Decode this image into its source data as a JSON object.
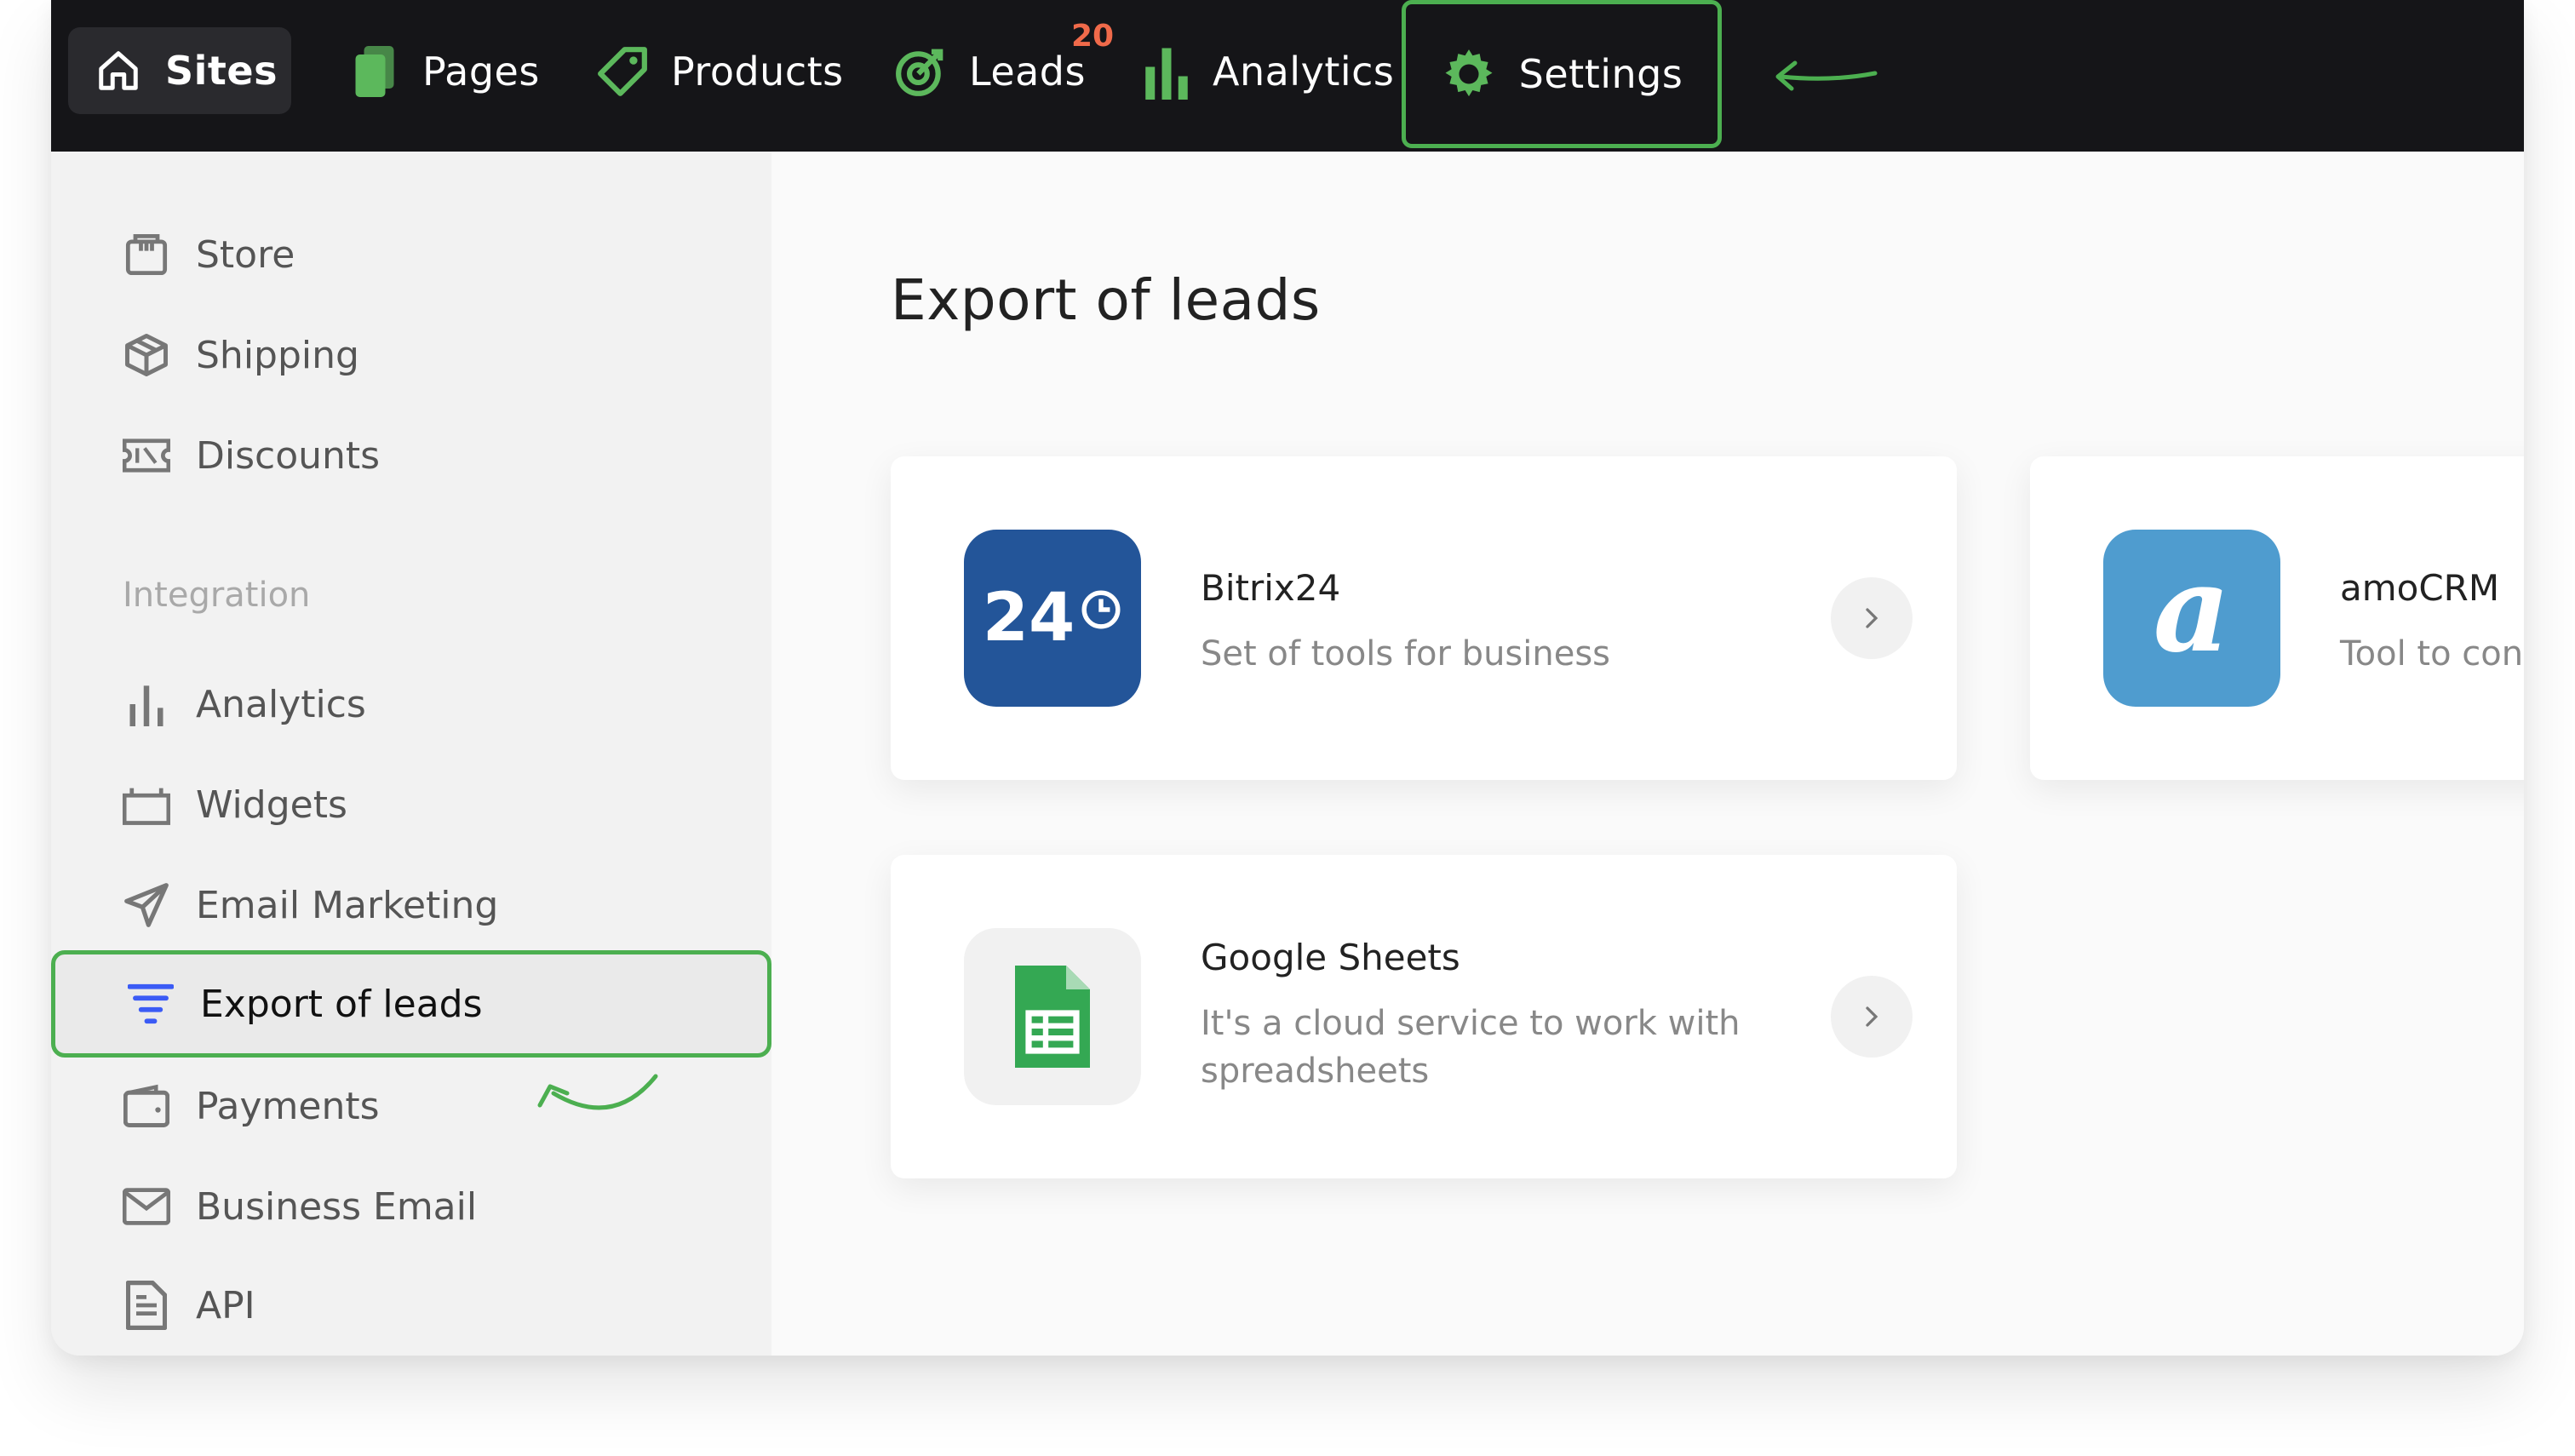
{
  "nav": {
    "items": [
      {
        "label": "Sites",
        "icon": "home-icon"
      },
      {
        "label": "Pages",
        "icon": "pages-icon"
      },
      {
        "label": "Products",
        "icon": "tag-icon"
      },
      {
        "label": "Leads",
        "icon": "target-icon",
        "badge": "20"
      },
      {
        "label": "Analytics",
        "icon": "bar-chart-icon"
      },
      {
        "label": "Settings",
        "icon": "gear-icon"
      }
    ],
    "accent": "#4caf50",
    "badge_color": "#f06a4a"
  },
  "sidebar": {
    "items_top": [
      {
        "label": "Store",
        "icon": "store-icon"
      },
      {
        "label": "Shipping",
        "icon": "box-icon"
      },
      {
        "label": "Discounts",
        "icon": "ticket-icon"
      }
    ],
    "heading": "Integration",
    "items_integration": [
      {
        "label": "Analytics",
        "icon": "bar-chart-icon"
      },
      {
        "label": "Widgets",
        "icon": "widget-icon"
      },
      {
        "label": "Email Marketing",
        "icon": "send-icon"
      },
      {
        "label": "Export of leads",
        "icon": "filter-icon",
        "active": true
      },
      {
        "label": "Payments",
        "icon": "wallet-icon"
      },
      {
        "label": "Business Email",
        "icon": "mail-icon"
      },
      {
        "label": "API",
        "icon": "document-icon"
      }
    ]
  },
  "main": {
    "title": "Export of leads",
    "cards": [
      {
        "name": "Bitrix24",
        "description": "Set of tools for business",
        "logo_text": "24",
        "logo_color": "#235599"
      },
      {
        "name": "amoCRM",
        "description": "Tool to con",
        "logo_text": "a",
        "logo_color": "#4f9ccf"
      },
      {
        "name": "Google Sheets",
        "description": "It's a cloud service to work with spreadsheets",
        "logo_color": "#34a853"
      }
    ]
  }
}
